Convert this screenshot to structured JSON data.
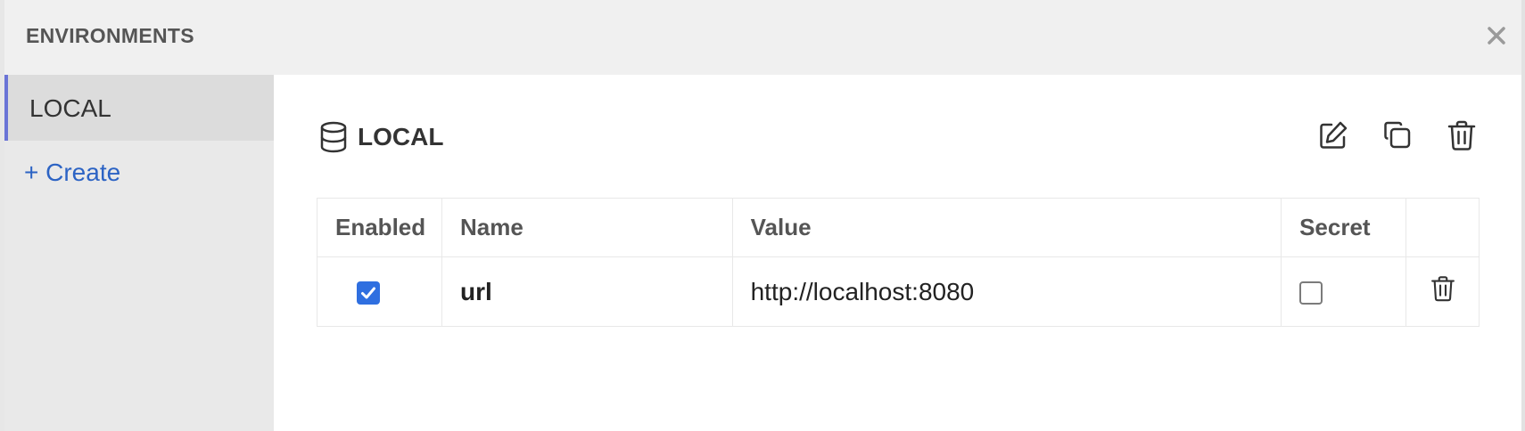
{
  "header": {
    "title": "ENVIRONMENTS",
    "close_icon": "close-icon"
  },
  "sidebar": {
    "items": [
      {
        "label": "LOCAL",
        "active": true
      }
    ],
    "create_label": "+ Create"
  },
  "environment": {
    "name": "LOCAL",
    "icon": "database-icon",
    "actions": [
      "edit-icon",
      "duplicate-icon",
      "trash-icon"
    ]
  },
  "table": {
    "columns": [
      "Enabled",
      "Name",
      "Value",
      "Secret"
    ],
    "rows": [
      {
        "enabled": true,
        "name": "url",
        "value": "http://localhost:8080",
        "secret": false
      }
    ]
  },
  "colors": {
    "accent": "#6a74d6",
    "link": "#2c63c4",
    "checkbox": "#2f6fe0"
  }
}
